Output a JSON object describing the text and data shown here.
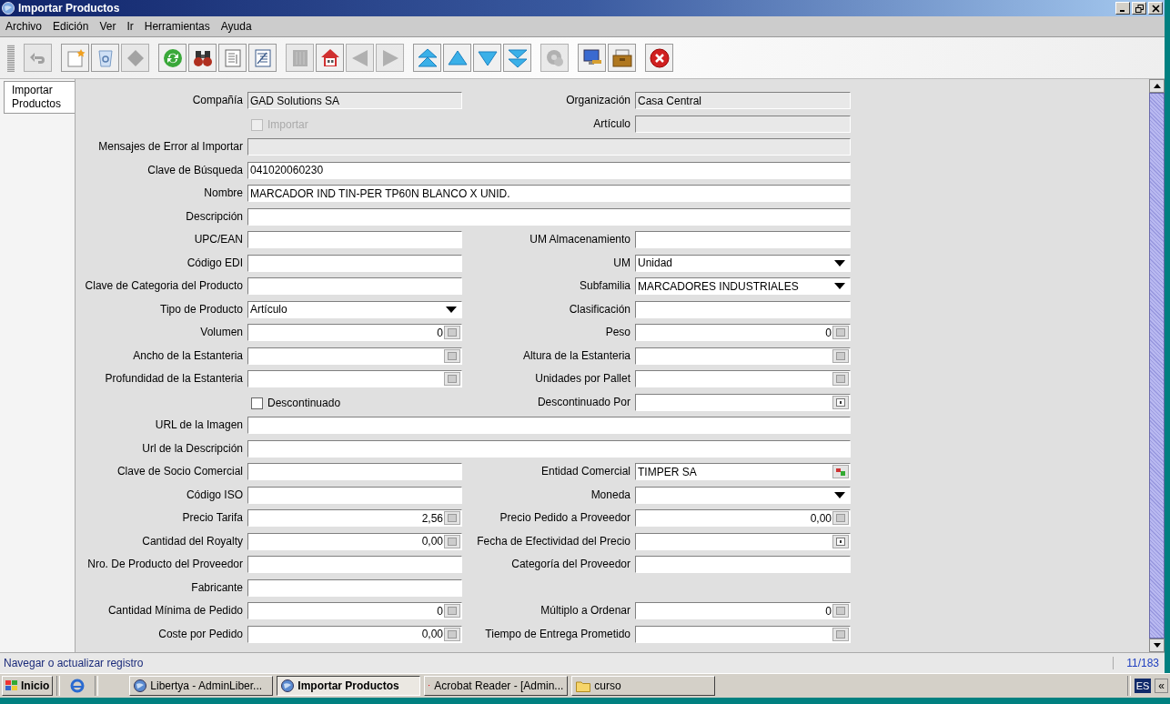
{
  "window": {
    "title": "Importar Productos"
  },
  "menu": [
    "Archivo",
    "Edición",
    "Ver",
    "Ir",
    "Herramientas",
    "Ayuda"
  ],
  "toolbar": [
    [
      {
        "disabled": true
      }
    ],
    [
      {
        "disabled": false
      },
      {
        "disabled": false
      },
      {
        "disabled": true
      }
    ],
    [
      {
        "disabled": false
      },
      {
        "disabled": false
      },
      {
        "disabled": false
      },
      {
        "disabled": false
      }
    ],
    [
      {
        "disabled": true
      },
      {
        "disabled": false
      },
      {
        "disabled": true
      },
      {
        "disabled": true
      }
    ],
    [
      {
        "disabled": false
      },
      {
        "disabled": false
      },
      {
        "disabled": false
      },
      {
        "disabled": false
      }
    ],
    [
      {
        "disabled": true
      }
    ],
    [
      {
        "disabled": false
      },
      {
        "disabled": false
      }
    ],
    [
      {
        "disabled": false
      }
    ]
  ],
  "tabs": [
    {
      "label": "Importar Productos",
      "selected": true
    }
  ],
  "form": [
    {
      "kind": "pair",
      "left": {
        "label": "Compañía",
        "kind": "readonly",
        "value": "GAD Solutions SA"
      },
      "right": {
        "label": "Organización",
        "kind": "readonly",
        "value": "Casa Central"
      }
    },
    {
      "kind": "pair",
      "left": {
        "kind": "checkbox",
        "label": "Importar",
        "checked": false,
        "disabled": true
      },
      "right": {
        "label": "Artículo",
        "kind": "readonly"
      }
    },
    {
      "kind": "wide",
      "left": {
        "label": "Mensajes de Error al Importar",
        "kind": "readonly"
      }
    },
    {
      "kind": "wide",
      "left": {
        "label": "Clave de Búsqueda",
        "kind": "text",
        "value": "041020060230"
      }
    },
    {
      "kind": "wide",
      "left": {
        "label": "Nombre",
        "kind": "text",
        "value": "MARCADOR IND TIN-PER TP60N BLANCO X UNID."
      }
    },
    {
      "kind": "wide",
      "left": {
        "label": "Descripción",
        "kind": "text"
      }
    },
    {
      "kind": "pair",
      "left": {
        "label": "UPC/EAN",
        "kind": "text"
      },
      "right": {
        "label": "UM Almacenamiento",
        "kind": "text"
      }
    },
    {
      "kind": "pair",
      "left": {
        "label": "Código EDI",
        "kind": "text"
      },
      "right": {
        "label": "UM",
        "kind": "combo",
        "value": "Unidad"
      }
    },
    {
      "kind": "pair",
      "left": {
        "label": "Clave de Categoria del Producto",
        "kind": "text"
      },
      "right": {
        "label": "Subfamilia",
        "kind": "combo",
        "value": "MARCADORES INDUSTRIALES"
      }
    },
    {
      "kind": "pair",
      "left": {
        "label": "Tipo de Producto",
        "kind": "combo",
        "value": "Artículo"
      },
      "right": {
        "label": "Clasificación",
        "kind": "text"
      }
    },
    {
      "kind": "pair",
      "left": {
        "label": "Volumen",
        "kind": "number",
        "value": "0"
      },
      "right": {
        "label": "Peso",
        "kind": "number",
        "value": "0"
      }
    },
    {
      "kind": "pair",
      "left": {
        "label": "Ancho de la Estanteria",
        "kind": "number"
      },
      "right": {
        "label": "Altura de la Estanteria",
        "kind": "number"
      }
    },
    {
      "kind": "pair",
      "left": {
        "label": "Profundidad de la Estanteria",
        "kind": "number"
      },
      "right": {
        "label": "Unidades por Pallet",
        "kind": "number"
      }
    },
    {
      "kind": "pair",
      "left": {
        "kind": "checkbox",
        "label": "Descontinuado",
        "checked": false,
        "disabled": false
      },
      "right": {
        "label": "Descontinuado Por",
        "kind": "date"
      }
    },
    {
      "kind": "wide",
      "left": {
        "label": "URL de la Imagen",
        "kind": "text"
      }
    },
    {
      "kind": "wide",
      "left": {
        "label": "Url de la Descripción",
        "kind": "text"
      }
    },
    {
      "kind": "pair",
      "left": {
        "label": "Clave de Socio Comercial",
        "kind": "text"
      },
      "right": {
        "label": "Entidad Comercial",
        "kind": "search",
        "value": "TIMPER SA"
      }
    },
    {
      "kind": "pair",
      "left": {
        "label": "Código ISO",
        "kind": "text"
      },
      "right": {
        "label": "Moneda",
        "kind": "combo"
      }
    },
    {
      "kind": "pair",
      "left": {
        "label": "Precio Tarifa",
        "kind": "number",
        "value": "2,56"
      },
      "right": {
        "label": "Precio Pedido a Proveedor",
        "kind": "number",
        "value": "0,00"
      }
    },
    {
      "kind": "pair",
      "left": {
        "label": "Cantidad del Royalty",
        "kind": "number",
        "value": "0,00"
      },
      "right": {
        "label": "Fecha de Efectividad del Precio",
        "kind": "date"
      }
    },
    {
      "kind": "pair",
      "left": {
        "label": "Nro. De Producto del Proveedor",
        "kind": "text"
      },
      "right": {
        "label": "Categoría del Proveedor",
        "kind": "text"
      }
    },
    {
      "kind": "pair",
      "left": {
        "label": "Fabricante",
        "kind": "text"
      }
    },
    {
      "kind": "pair",
      "left": {
        "label": "Cantidad Mínima de Pedido",
        "kind": "number",
        "value": "0"
      },
      "right": {
        "label": "Múltiplo a Ordenar",
        "kind": "number",
        "value": "0"
      }
    },
    {
      "kind": "pair",
      "left": {
        "label": "Coste por Pedido",
        "kind": "number",
        "value": "0,00"
      },
      "right": {
        "label": "Tiempo de Entrega Prometido",
        "kind": "number"
      }
    }
  ],
  "status_bar": {
    "message": "Navegar o actualizar registro",
    "record": "11/183"
  },
  "taskbar": {
    "start": "Inicio",
    "items": [
      {
        "label": "Libertya    -    AdminLiber...",
        "selected": false
      },
      {
        "label": "Importar Productos",
        "selected": true
      },
      {
        "label": "Acrobat Reader - [Admin...",
        "selected": false
      },
      {
        "label": "curso",
        "selected": false
      }
    ],
    "tray": [
      "ES",
      "«"
    ]
  }
}
